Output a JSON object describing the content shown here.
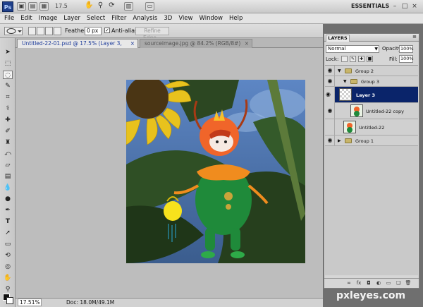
{
  "app": {
    "logo": "Ps",
    "zoom_readout": "17.5",
    "workspace": "ESSENTIALS",
    "win_min": "–",
    "win_max": "□",
    "win_close": "×",
    "watermark": "pxleyes.com"
  },
  "menu": [
    "File",
    "Edit",
    "Image",
    "Layer",
    "Select",
    "Filter",
    "Analysis",
    "3D",
    "View",
    "Window",
    "Help"
  ],
  "options": {
    "feather_label": "Feather:",
    "feather_value": "0 px",
    "antialias_label": "Anti-alias",
    "antialias_check": "✓",
    "refine_edge": "Refine Edge..."
  },
  "tabs": [
    {
      "label": "Untitled-22-01.psd @ 17.5% (Layer 3, RGB/8#)",
      "close": "×"
    },
    {
      "label": "sourceimage.jpg @ 84.2% (RGB/8#)",
      "close": "×"
    }
  ],
  "status": {
    "zoom": "17.51%",
    "doc": "Doc: 18.0M/49.1M"
  },
  "layers_panel": {
    "tab": "LAYERS",
    "blend_mode": "Normal",
    "opacity_label": "Opacity:",
    "opacity_value": "100%",
    "lock_label": "Lock:",
    "fill_label": "Fill:",
    "fill_value": "100%",
    "layers": [
      {
        "name": "Group 2",
        "visible": true
      },
      {
        "name": "Group 3",
        "visible": true
      },
      {
        "name": "Layer 3",
        "visible": true,
        "selected": true
      },
      {
        "name": "Untitled-22 copy",
        "visible": true
      },
      {
        "name": "Untitled-22",
        "visible": false
      },
      {
        "name": "Group 1",
        "visible": true
      }
    ]
  },
  "icons": {
    "eye": "eye-icon",
    "folder": "folder-icon"
  },
  "colors": {
    "selected_row": "#0a246a",
    "ps_blue": "#1f3f8a"
  }
}
